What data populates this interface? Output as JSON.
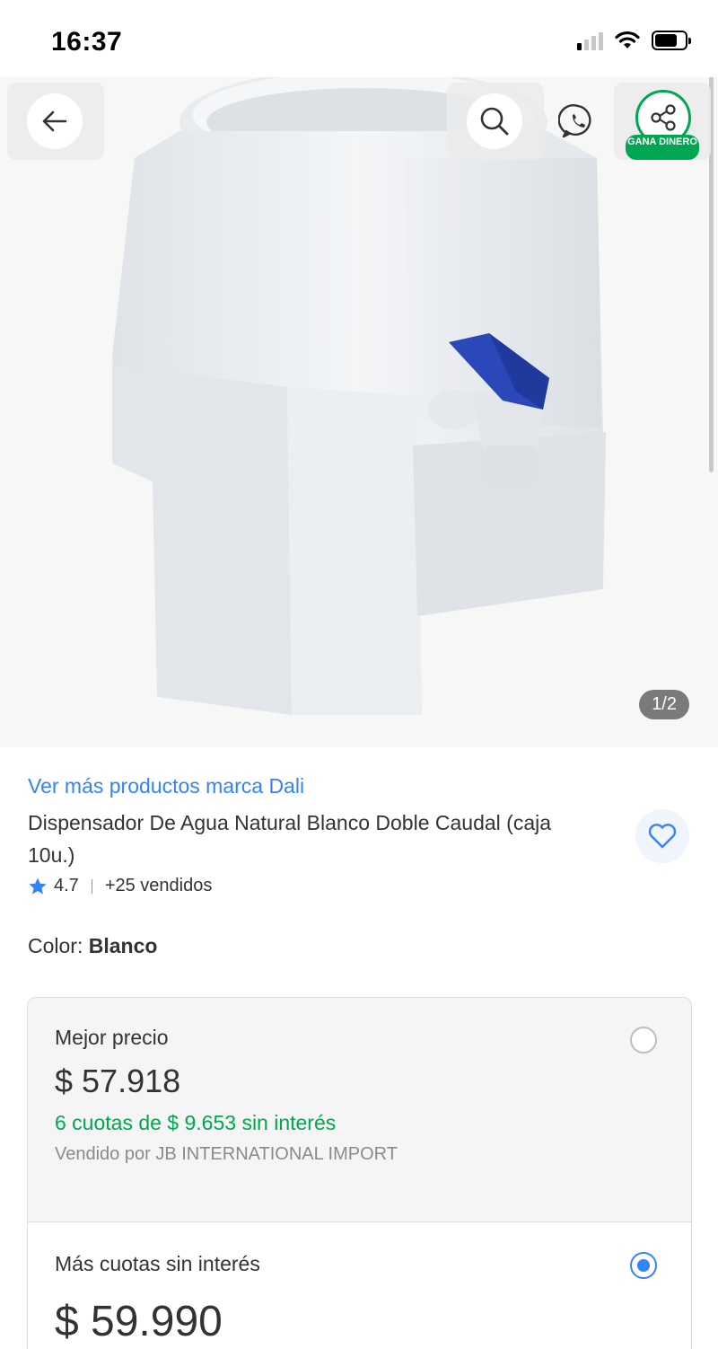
{
  "status_bar": {
    "time": "16:37",
    "signal_bars_on": 1,
    "battery_level": 0.75
  },
  "gallery": {
    "counter": "1/2",
    "gana_badge": "GANA DINERO",
    "icons": {
      "back": "arrow-left-icon",
      "search": "search-icon",
      "whatsapp": "whatsapp-icon",
      "share": "share-icon"
    }
  },
  "product": {
    "brand_link": "Ver más productos marca Dali",
    "title": "Dispensador De Agua Natural Blanco Doble Caudal (caja 10u.)",
    "rating": "4.7",
    "sold": "+25 vendidos",
    "color_label": "Color:",
    "color_value": "Blanco"
  },
  "options": [
    {
      "title": "Mejor precio",
      "price": "$ 57.918",
      "installments": "6 cuotas de $ 9.653 sin interés",
      "seller": "Vendido por JB INTERNATIONAL IMPORT",
      "selected": false
    },
    {
      "title": "Más cuotas sin interés",
      "price": "$ 59.990",
      "selected": true
    }
  ],
  "colors": {
    "link_blue": "#3483fa",
    "green": "#00a650",
    "tap_blue": "#2a48b8"
  }
}
